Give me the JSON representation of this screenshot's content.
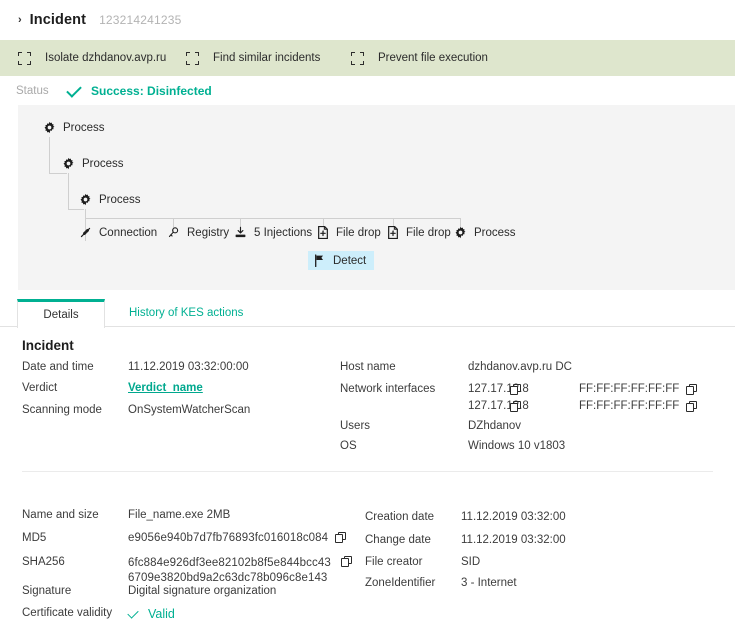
{
  "header": {
    "chevron": "›",
    "title": "Incident",
    "id": "123214241235"
  },
  "actions": [
    {
      "icon": "selection-square-icon",
      "label": "Isolate dzhdanov.avp.ru"
    },
    {
      "icon": "selection-square-icon",
      "label": "Find similar incidents"
    },
    {
      "icon": "selection-square-icon",
      "label": "Prevent file execution"
    }
  ],
  "status": {
    "label": "Status",
    "icon": "check-icon",
    "text": "Success: Disinfected",
    "color": "#00b092"
  },
  "tree": {
    "nodes": [
      {
        "icon": "gear-icon",
        "label": "Process"
      },
      {
        "icon": "gear-icon",
        "label": "Process"
      },
      {
        "icon": "gear-icon",
        "label": "Process"
      },
      {
        "icon": "connection-icon",
        "label": "Connection"
      },
      {
        "icon": "key-icon",
        "label": "Registry"
      },
      {
        "icon": "injection-icon",
        "label": "5 Injections"
      },
      {
        "icon": "file-drop-icon",
        "label": "File drop"
      },
      {
        "icon": "file-drop-icon",
        "label": "File drop"
      },
      {
        "icon": "gear-icon",
        "label": "Process"
      },
      {
        "icon": "flag-icon",
        "label": "Detect"
      }
    ],
    "highlight_color": "#cdeefb"
  },
  "tabs": [
    {
      "label": "Details",
      "active": true
    },
    {
      "label": "History of KES actions",
      "active": false
    }
  ],
  "incident": {
    "title": "Incident",
    "left": [
      {
        "label": "Date and time",
        "value": "11.12.2019 03:32:00:00"
      },
      {
        "label": "Verdict",
        "value": "Verdict_name",
        "link": true
      },
      {
        "label": "Scanning mode",
        "value": "OnSystemWatcherScan"
      }
    ],
    "right": [
      {
        "label": "Host name",
        "value": "dzhdanov.avp.ru  DC"
      },
      {
        "label": "Network interfaces",
        "rows": [
          {
            "ip": "127.17.12.8",
            "mac": "FF:FF:FF:FF:FF:FF"
          },
          {
            "ip": "127.17.12.8",
            "mac": "FF:FF:FF:FF:FF:FF"
          }
        ]
      },
      {
        "label": "Users",
        "value": "DZhdanov"
      },
      {
        "label": "OS",
        "value": "Windows 10 v1803"
      }
    ]
  },
  "file": {
    "left": [
      {
        "label": "Name and size",
        "value": "File_name.exe   2MB"
      },
      {
        "label": "MD5",
        "value": "e9056e940b7d7fb76893fc016018c084",
        "copy": true
      },
      {
        "label": "SHA256",
        "value": "6fc884e926df3ee82102b8f5e844bcc43",
        "value2": "6709e3820bd9a2c63dc78b096c8e143",
        "copy": true
      },
      {
        "label": "Signature",
        "value": "Digital signature organization"
      },
      {
        "label": "Certificate validity",
        "value": "Valid",
        "valid": true
      }
    ],
    "right": [
      {
        "label": "Creation date",
        "value": "11.12.2019 03:32:00"
      },
      {
        "label": "Change date",
        "value": "11.12.2019 03:32:00"
      },
      {
        "label": "File creator",
        "value": "SID"
      },
      {
        "label": "ZoneIdentifier",
        "value": "3 - Internet"
      }
    ]
  },
  "colors": {
    "action_bar": "#dee6cd",
    "accent": "#00b092",
    "panel": "#f4f4f4"
  }
}
